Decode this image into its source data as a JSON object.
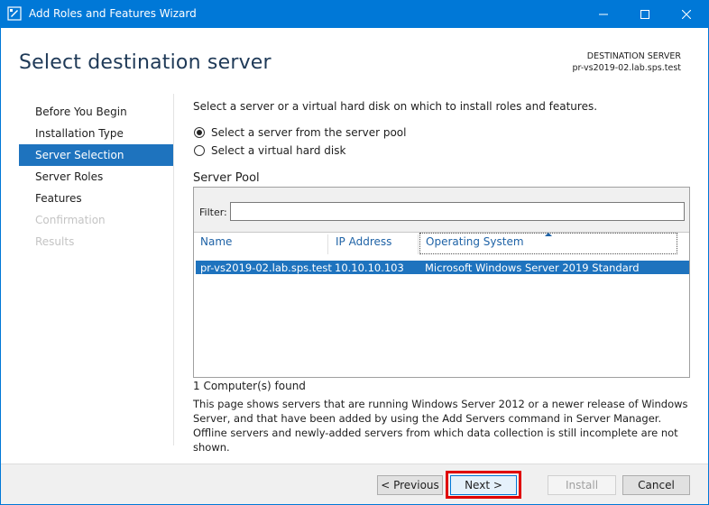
{
  "window": {
    "title": "Add Roles and Features Wizard",
    "controls": {
      "minimize": "minimize-icon",
      "maximize": "maximize-icon",
      "close": "close-icon"
    }
  },
  "header": {
    "title": "Select destination server",
    "destination_label": "DESTINATION SERVER",
    "destination_server": "pr-vs2019-02.lab.sps.test"
  },
  "sidebar": {
    "items": [
      {
        "label": "Before You Begin",
        "state": "normal"
      },
      {
        "label": "Installation Type",
        "state": "normal"
      },
      {
        "label": "Server Selection",
        "state": "active"
      },
      {
        "label": "Server Roles",
        "state": "normal"
      },
      {
        "label": "Features",
        "state": "normal"
      },
      {
        "label": "Confirmation",
        "state": "disabled"
      },
      {
        "label": "Results",
        "state": "disabled"
      }
    ]
  },
  "main": {
    "intro": "Select a server or a virtual hard disk on which to install roles and features.",
    "options": [
      {
        "label": "Select a server from the server pool",
        "checked": true
      },
      {
        "label": "Select a virtual hard disk",
        "checked": false
      }
    ],
    "pool": {
      "title": "Server Pool",
      "filter_label": "Filter:",
      "filter_value": "",
      "columns": [
        "Name",
        "IP Address",
        "Operating System"
      ],
      "rows": [
        {
          "name": "pr-vs2019-02.lab.sps.test",
          "ip": "10.10.10.103",
          "os": "Microsoft Windows Server 2019 Standard",
          "selected": true
        }
      ],
      "found_text": "1 Computer(s) found"
    },
    "description": "This page shows servers that are running Windows Server 2012 or a newer release of Windows Server, and that have been added by using the Add Servers command in Server Manager. Offline servers and newly-added servers from which data collection is still incomplete are not shown."
  },
  "footer": {
    "previous": "< Previous",
    "next": "Next >",
    "install": "Install",
    "cancel": "Cancel"
  },
  "colors": {
    "accent": "#0078d7",
    "selection": "#1e73be",
    "highlight_box": "#e00000",
    "title_text": "#1e3957"
  }
}
